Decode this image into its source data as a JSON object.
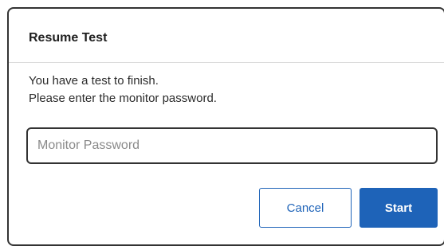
{
  "dialog": {
    "title": "Resume Test",
    "message_line1": "You have a test to finish.",
    "message_line2": "Please enter the monitor password.",
    "password_field": {
      "value": "",
      "placeholder": "Monitor Password"
    },
    "cancel_label": "Cancel",
    "start_label": "Start"
  },
  "colors": {
    "primary": "#1e63b8",
    "border": "#333333"
  }
}
